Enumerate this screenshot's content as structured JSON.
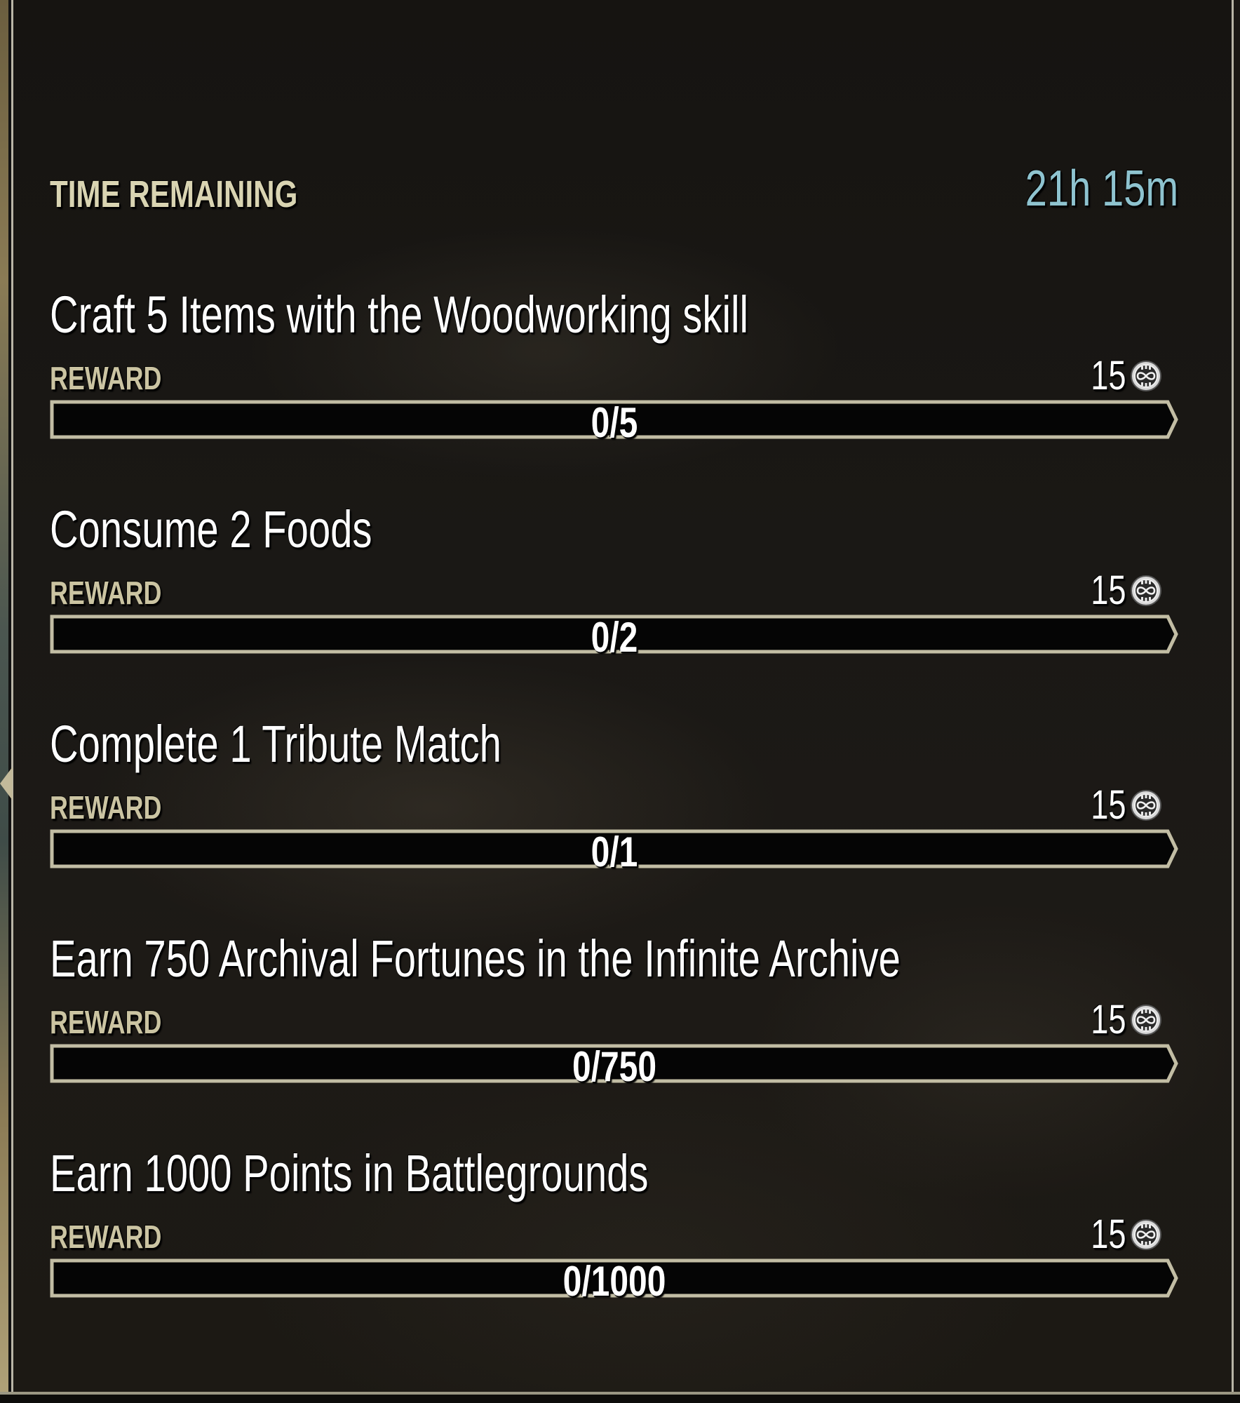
{
  "header": {
    "time_remaining_label": "TIME REMAINING",
    "time_remaining_value": "21h 15m"
  },
  "colors": {
    "label": "#d9d4b2",
    "timer": "#8ec3cf",
    "title": "#ffffff",
    "bar_border": "#c2bda4",
    "bar_fill": "#050505"
  },
  "quests": [
    {
      "title": "Craft 5 Items with the Woodworking skill",
      "reward_label": "REWARD",
      "reward_amount": "15",
      "reward_icon": "seal-coin-icon",
      "progress_text": "0/5",
      "progress_current": 0,
      "progress_max": 5
    },
    {
      "title": "Consume 2 Foods",
      "reward_label": "REWARD",
      "reward_amount": "15",
      "reward_icon": "seal-coin-icon",
      "progress_text": "0/2",
      "progress_current": 0,
      "progress_max": 2
    },
    {
      "title": "Complete 1 Tribute Match",
      "reward_label": "REWARD",
      "reward_amount": "15",
      "reward_icon": "seal-coin-icon",
      "progress_text": "0/1",
      "progress_current": 0,
      "progress_max": 1
    },
    {
      "title": "Earn 750 Archival Fortunes in the Infinite Archive",
      "reward_label": "REWARD",
      "reward_amount": "15",
      "reward_icon": "seal-coin-icon",
      "progress_text": "0/750",
      "progress_current": 0,
      "progress_max": 750
    },
    {
      "title": "Earn 1000 Points in Battlegrounds",
      "reward_label": "REWARD",
      "reward_amount": "15",
      "reward_icon": "seal-coin-icon",
      "progress_text": "0/1000",
      "progress_current": 0,
      "progress_max": 1000
    }
  ]
}
